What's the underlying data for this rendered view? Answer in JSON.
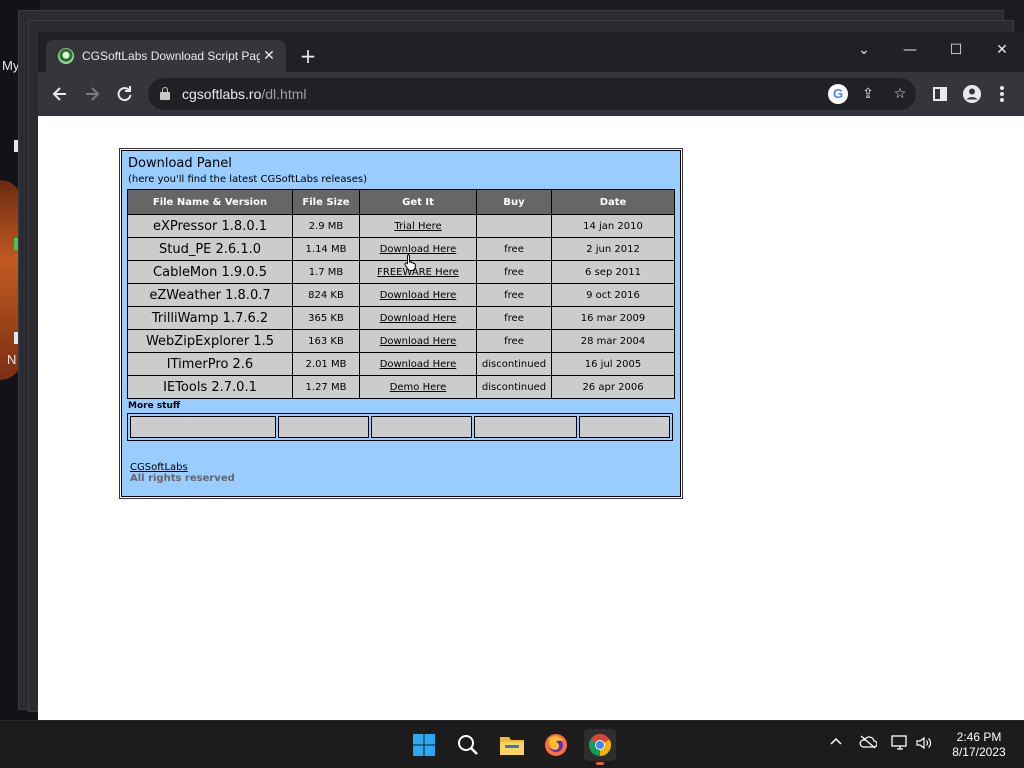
{
  "desktop": {
    "label_my": "My",
    "label_n": "N"
  },
  "browser": {
    "tab_title": "CGSoftLabs Download Script Pag",
    "url_host": "cgsoftlabs.ro",
    "url_path": "/dl.html",
    "minimize": "—",
    "maximize": "☐",
    "close": "✕",
    "tab_list": "⌄"
  },
  "panel": {
    "title": "Download Panel",
    "subtitle": "(here you'll find the latest CGSoftLabs releases)",
    "headers": [
      "File Name & Version",
      "File Size",
      "Get It",
      "Buy",
      "Date"
    ],
    "rows": [
      {
        "name": "eXPressor 1.8.0.1",
        "size": "2.9 MB",
        "get": "Trial Here",
        "buy": "",
        "date": "14 jan 2010"
      },
      {
        "name": "Stud_PE 2.6.1.0",
        "size": "1.14 MB",
        "get": "Download Here",
        "buy": "free",
        "date": "2 jun 2012"
      },
      {
        "name": "CableMon 1.9.0.5",
        "size": "1.7 MB",
        "get": "FREEWARE Here",
        "buy": "free",
        "date": "6 sep 2011"
      },
      {
        "name": "eZWeather 1.8.0.7",
        "size": "824 KB",
        "get": "Download Here",
        "buy": "free",
        "date": "9 oct 2016"
      },
      {
        "name": "TrilliWamp 1.7.6.2",
        "size": "365 KB",
        "get": "Download Here",
        "buy": "free",
        "date": "16 mar 2009"
      },
      {
        "name": "WebZipExplorer 1.5",
        "size": "163 KB",
        "get": "Download Here",
        "buy": "free",
        "date": "28 mar 2004"
      },
      {
        "name": "ITimerPro 2.6",
        "size": "2.01 MB",
        "get": "Download Here",
        "buy": "discontinued",
        "date": "16 jul 2005"
      },
      {
        "name": "IETools 2.7.0.1",
        "size": "1.27 MB",
        "get": "Demo Here",
        "buy": "discontinued",
        "date": "26 apr 2006"
      }
    ],
    "more_label": "More stuff",
    "footer_link": "CGSoftLabs",
    "footer_text": "All rights reserved"
  },
  "taskbar": {
    "time": "2:46 PM",
    "date": "8/17/2023"
  },
  "colors": {
    "panel_bg": "#99ccff",
    "header_bg": "#666666",
    "cell_bg": "#cccccc",
    "chrome_dark": "#202124",
    "chrome_toolbar": "#35363a"
  }
}
